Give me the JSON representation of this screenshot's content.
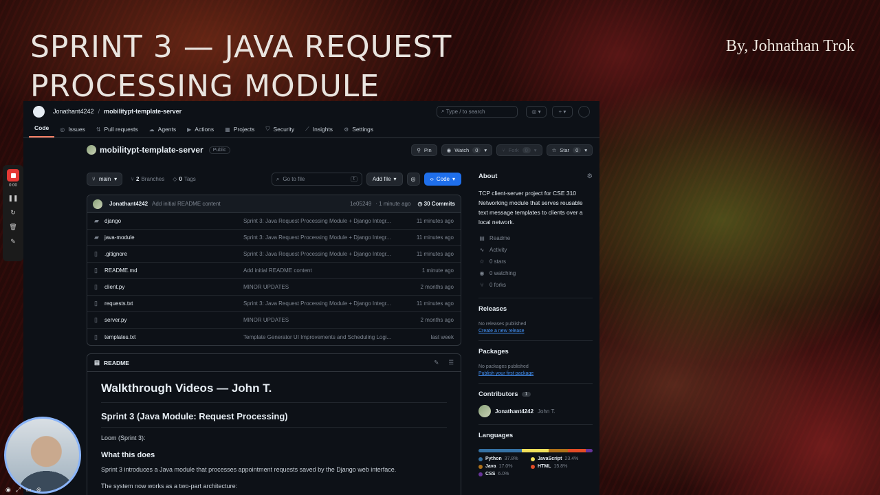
{
  "slide": {
    "title": "SPRINT 3 — JAVA REQUEST PROCESSING MODULE",
    "byline": "By, Johnathan Trok"
  },
  "header": {
    "owner": "Jonathant4242",
    "separator": "/",
    "repo": "mobilitypt-template-server",
    "search_placeholder": "Type / to search"
  },
  "tabs": [
    {
      "label": "Code",
      "icon": "code-icon"
    },
    {
      "label": "Issues",
      "icon": "issue-icon"
    },
    {
      "label": "Pull requests",
      "icon": "pull-request-icon"
    },
    {
      "label": "Agents",
      "icon": "agent-icon"
    },
    {
      "label": "Actions",
      "icon": "play-icon"
    },
    {
      "label": "Projects",
      "icon": "table-icon"
    },
    {
      "label": "Security",
      "icon": "shield-icon"
    },
    {
      "label": "Insights",
      "icon": "graph-icon"
    },
    {
      "label": "Settings",
      "icon": "gear-icon"
    }
  ],
  "repo": {
    "name": "mobilitypt-template-server",
    "visibility": "Public",
    "pin": "Pin",
    "watch": "Watch",
    "watch_count": "0",
    "fork": "Fork",
    "fork_count": "0",
    "star": "Star",
    "star_count": "0"
  },
  "filebar": {
    "branch": "main",
    "branches_count": "2",
    "branches_label": "Branches",
    "tags_count": "0",
    "tags_label": "Tags",
    "goto_placeholder": "Go to file",
    "goto_key": "t",
    "add_file": "Add file",
    "code": "Code"
  },
  "latest_commit": {
    "author": "Jonathant4242",
    "message": "Add initial README content",
    "sha": "1e05249",
    "time": "· 1 minute ago",
    "commits": "30 Commits"
  },
  "files": [
    {
      "name": "django",
      "type": "folder",
      "message": "Sprint 3: Java Request Processing Module + Django Integr...",
      "time": "11 minutes ago"
    },
    {
      "name": "java-module",
      "type": "folder",
      "message": "Sprint 3: Java Request Processing Module + Django Integr...",
      "time": "11 minutes ago"
    },
    {
      "name": ".gitignore",
      "type": "file",
      "message": "Sprint 3: Java Request Processing Module + Django Integr...",
      "time": "11 minutes ago"
    },
    {
      "name": "README.md",
      "type": "file",
      "message": "Add initial README content",
      "time": "1 minute ago"
    },
    {
      "name": "client.py",
      "type": "file",
      "message": "MINOR UPDATES",
      "time": "2 months ago"
    },
    {
      "name": "requests.txt",
      "type": "file",
      "message": "Sprint 3: Java Request Processing Module + Django Integr...",
      "time": "11 minutes ago"
    },
    {
      "name": "server.py",
      "type": "file",
      "message": "MINOR UPDATES",
      "time": "2 months ago"
    },
    {
      "name": "templates.txt",
      "type": "file",
      "message": "Template Generator UI Improvements and Scheduling Logi...",
      "time": "last week"
    }
  ],
  "readme": {
    "tab": "README",
    "h1": "Walkthrough Videos — John T.",
    "h2": "Sprint 3 (Java Module: Request Processing)",
    "loom": "Loom (Sprint 3):",
    "h3": "What this does",
    "p1": "Sprint 3 introduces a Java module that processes appointment requests saved by the Django web interface.",
    "p2": "The system now works as a two-part architecture:"
  },
  "about": {
    "title": "About",
    "description": "TCP client-server project for CSE 310 Networking module that serves reusable text message templates to clients over a local network.",
    "links": [
      {
        "label": "Readme",
        "icon": "book-icon"
      },
      {
        "label": "Activity",
        "icon": "pulse-icon"
      },
      {
        "label": "0 stars",
        "icon": "star-icon"
      },
      {
        "label": "0 watching",
        "icon": "eye-icon"
      },
      {
        "label": "0 forks",
        "icon": "fork-icon"
      }
    ]
  },
  "releases": {
    "title": "Releases",
    "empty": "No releases published",
    "link": "Create a new release"
  },
  "packages": {
    "title": "Packages",
    "empty": "No packages published",
    "link": "Publish your first package"
  },
  "contributors": {
    "title": "Contributors",
    "count": "1",
    "handle": "Jonathant4242",
    "name": "John T."
  },
  "languages": {
    "title": "Languages",
    "items": [
      {
        "name": "Python",
        "pct": "37.8%",
        "value": 37.8,
        "color": "#3572A5"
      },
      {
        "name": "JavaScript",
        "pct": "23.4%",
        "value": 23.4,
        "color": "#f1e05a"
      },
      {
        "name": "Java",
        "pct": "17.0%",
        "value": 17.0,
        "color": "#b07219"
      },
      {
        "name": "HTML",
        "pct": "15.8%",
        "value": 15.8,
        "color": "#e34c26"
      },
      {
        "name": "CSS",
        "pct": "6.0%",
        "value": 6.0,
        "color": "#663399"
      }
    ]
  },
  "recorder": {
    "time": "0:00"
  }
}
